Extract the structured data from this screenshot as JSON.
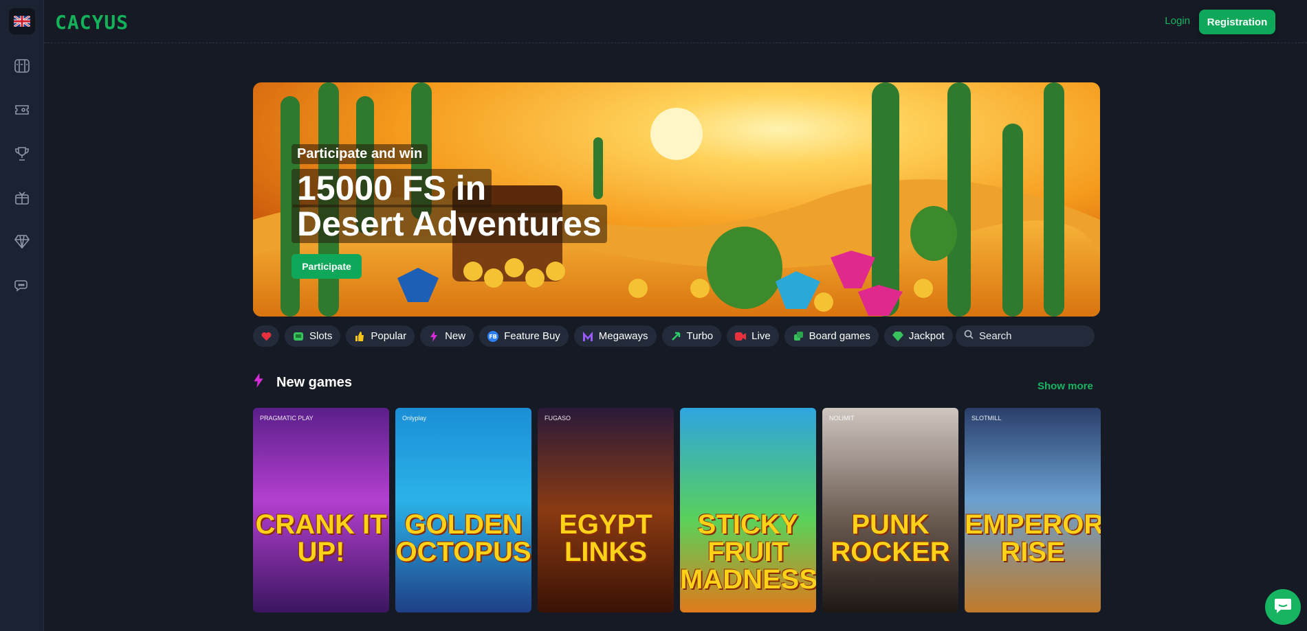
{
  "header": {
    "logo": "CACYUS",
    "login_label": "Login",
    "registration_label": "Registration"
  },
  "sidebar": {
    "items": [
      "slots-icon",
      "ticket-icon",
      "trophy-icon",
      "gift-icon",
      "diamond-icon",
      "chat-bubbles-icon"
    ]
  },
  "banner": {
    "subtitle": "Participate and win",
    "title_line1": "15000 FS in",
    "title_line2": "Desert Adventures",
    "button_label": "Participate"
  },
  "categories": [
    {
      "icon": "heart-icon",
      "label": ""
    },
    {
      "icon": "slot-machine-icon",
      "label": "Slots"
    },
    {
      "icon": "thumbs-up-icon",
      "label": "Popular"
    },
    {
      "icon": "lightning-icon",
      "label": "New"
    },
    {
      "icon": "fb-icon",
      "label": "Feature Buy"
    },
    {
      "icon": "megaways-icon",
      "label": "Megaways"
    },
    {
      "icon": "turbo-icon",
      "label": "Turbo"
    },
    {
      "icon": "live-icon",
      "label": "Live"
    },
    {
      "icon": "board-icon",
      "label": "Board games"
    },
    {
      "icon": "jackpot-icon",
      "label": "Jackpot"
    }
  ],
  "search": {
    "placeholder": "Search"
  },
  "section": {
    "title": "New games",
    "show_more": "Show more"
  },
  "games": [
    {
      "title": "CRANK IT UP!",
      "provider": "PRAGMATIC PLAY"
    },
    {
      "title": "GOLDEN OCTOPUS",
      "provider": "Onlyplay"
    },
    {
      "title": "EGYPT LINKS",
      "provider": "FUGASO"
    },
    {
      "title": "STICKY FRUIT MADNESS",
      "provider": ""
    },
    {
      "title": "PUNK ROCKER",
      "provider": "NOLIMIT"
    },
    {
      "title": "EMPEROR'S RISE",
      "provider": "SLOTMILL"
    }
  ],
  "colors": {
    "accent": "#0fa85a",
    "background": "#151a24",
    "sidebar": "#1b2231",
    "chip": "#232b3a"
  }
}
